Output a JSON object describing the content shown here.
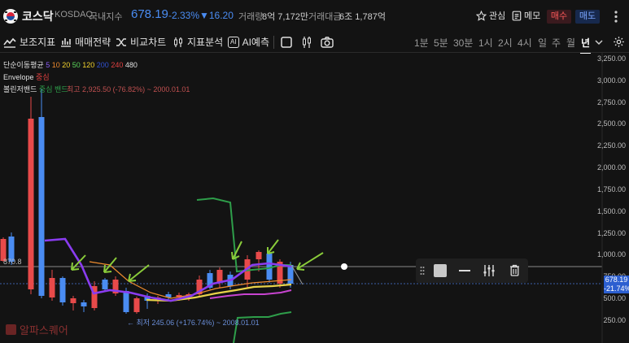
{
  "header": {
    "name": "코스닥",
    "code": "KOSDAQ",
    "kind": "국내지수",
    "price": "678.19",
    "change_pct": "-2.33%",
    "change_val": "▼16.20",
    "volume_label": "거래량",
    "volume": "8억 7,172만",
    "amount_label": "거래대금",
    "amount": "6조 1,787억",
    "watch_label": "관심",
    "memo_label": "메모",
    "buy_label": "매수",
    "sell_label": "매도"
  },
  "toolbar": {
    "indicator_label": "보조지표",
    "strategy_label": "매매전략",
    "compare_label": "비교차트",
    "analysis_label": "지표분석",
    "ai_label": "AI예측",
    "ai_badge": "AI",
    "periods": [
      "1분",
      "5분",
      "30분",
      "1시",
      "2시",
      "4시",
      "일",
      "주",
      "월",
      "년"
    ],
    "active_period": "년"
  },
  "legend": {
    "ma_label": "단순이동평균",
    "ma_periods": [
      "5",
      "10",
      "20",
      "50",
      "120",
      "200",
      "240",
      "480"
    ],
    "ma_colors": [
      "#8a5cf5",
      "#f08c2e",
      "#f2d32e",
      "#5ad65a",
      "#f2d32e",
      "#3050d0",
      "#e14040",
      "#e0e0e0"
    ],
    "envelope_label": "Envelope",
    "envelope_sub": "중심",
    "bollinger_label": "볼린저밴드",
    "bollinger_sub": "중심 밴드",
    "high_text": "최고 2,925.50 (-76.82%) ~ 2000.01.01",
    "low_text": "← 최저 245.06 (+176.74%) ~ 2008.01.01",
    "ref_value": "870.8"
  },
  "axis": {
    "labels": [
      "3,250.00",
      "3,000.00",
      "2,750.00",
      "2,500.00",
      "2,250.00",
      "2,000.00",
      "1,750.00",
      "1,500.00",
      "1,250.00",
      "1,000.00",
      "750.00",
      "500.00",
      "250.00"
    ],
    "current_price": "678.19",
    "current_pct": "-21.74%"
  },
  "watermark": "알파스퀘어",
  "colors": {
    "up": "#e84a4a",
    "down": "#4a8cf2",
    "ma5": "#8a3cf0",
    "ma10": "#f08c2e",
    "ma20": "#e8d24a",
    "bollinger": "#2e9e4a",
    "arrow": "#8acc3a"
  }
}
